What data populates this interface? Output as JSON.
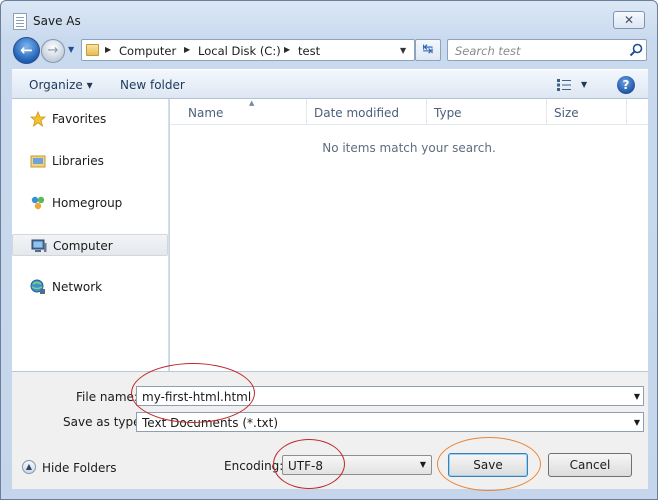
{
  "window": {
    "title": "Save As",
    "close_label": "✕"
  },
  "nav": {
    "back_label": "←",
    "forward_label": "→",
    "dropdown_label": "▼"
  },
  "address": {
    "crumbs": [
      "Computer",
      "Local Disk (C:)",
      "test"
    ],
    "separator": "▶",
    "dropdown_label": "▼",
    "refresh_label": "↹"
  },
  "search": {
    "placeholder": "Search test"
  },
  "toolbar": {
    "organize_label": "Organize ▾",
    "new_folder_label": "New folder",
    "views_dropdown": "▼",
    "help_label": "?"
  },
  "sidebar": {
    "items": [
      {
        "label": "Favorites",
        "icon": "star-icon"
      },
      {
        "label": "Libraries",
        "icon": "libraries-icon"
      },
      {
        "label": "Homegroup",
        "icon": "homegroup-icon"
      },
      {
        "label": "Computer",
        "icon": "computer-icon",
        "selected": true
      },
      {
        "label": "Network",
        "icon": "network-icon"
      }
    ]
  },
  "files": {
    "columns": [
      "Name",
      "Date modified",
      "Type",
      "Size"
    ],
    "sort_indicator": "▲",
    "empty_message": "No items match your search."
  },
  "form": {
    "filename_label": "File name:",
    "filename_value": "my-first-html.html",
    "savetype_label": "Save as type:",
    "savetype_value": "Text Documents (*.txt)",
    "encoding_label": "Encoding:",
    "encoding_value": "UTF-8",
    "dropdown_label": "▼"
  },
  "footer": {
    "hide_folders_label": "Hide Folders",
    "hide_folders_icon": "▲",
    "save_label": "Save",
    "cancel_label": "Cancel"
  },
  "colors": {
    "annotation_red": "#c0282c",
    "annotation_orange": "#e8873a",
    "accent_blue": "#1f5fb5"
  }
}
